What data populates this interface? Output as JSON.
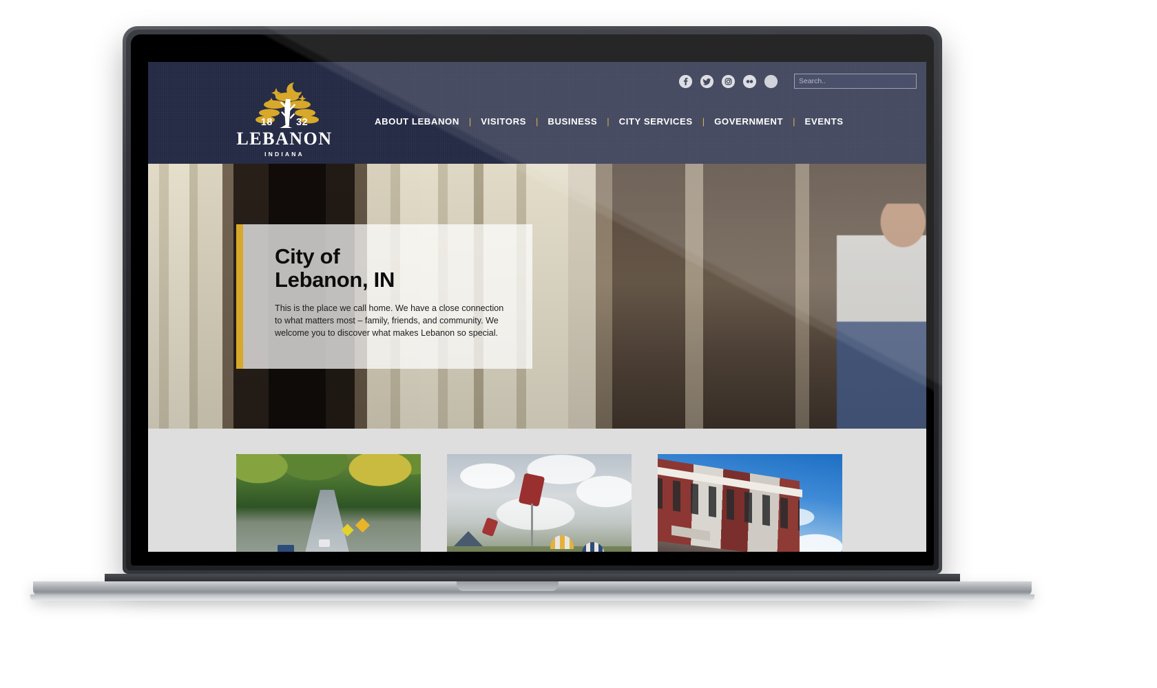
{
  "site": {
    "brand": {
      "logo_icon": "tree-moon-stars-logo",
      "year_left": "18",
      "year_right": "32",
      "name": "LEBANON",
      "subtitle": "INDIANA"
    },
    "social": [
      {
        "name": "facebook-icon",
        "label": "f"
      },
      {
        "name": "twitter-icon",
        "label": "t"
      },
      {
        "name": "instagram-icon",
        "label": "ig"
      },
      {
        "name": "flickr-icon",
        "label": "fl"
      },
      {
        "name": "social-extra-icon",
        "label": ""
      }
    ],
    "search": {
      "placeholder": "Search..",
      "value": ""
    },
    "nav": [
      {
        "label": "ABOUT LEBANON"
      },
      {
        "label": "VISITORS"
      },
      {
        "label": "BUSINESS"
      },
      {
        "label": "CITY SERVICES"
      },
      {
        "label": "GOVERNMENT"
      },
      {
        "label": "EVENTS"
      }
    ],
    "nav_separator": "|"
  },
  "hero": {
    "title": "City of\nLebanon, IN",
    "body": "This is the place we call home. We have a close connection to what matters most – family, friends, and community. We welcome you to discover what makes Lebanon so special.",
    "carousel": {
      "dots": 3,
      "active_index": 0
    },
    "photo_alt": "family-shopping-downtown-storefront"
  },
  "cards": [
    {
      "name": "tree-lined-street-card",
      "alt": "autumn tree-lined residential street"
    },
    {
      "name": "splash-pad-card",
      "alt": "water splash pad park with kite sculpture"
    },
    {
      "name": "downtown-buildings-card",
      "alt": "historic downtown brick storefronts"
    }
  ],
  "colors": {
    "header_navy": "#242a44",
    "accent_gold": "#d8a82a",
    "strip_gray": "#dedede",
    "nav_text": "#ffffff",
    "hero_card_bg": "rgba(255,255,255,0.72)"
  },
  "device": {
    "type": "laptop-mockup"
  }
}
